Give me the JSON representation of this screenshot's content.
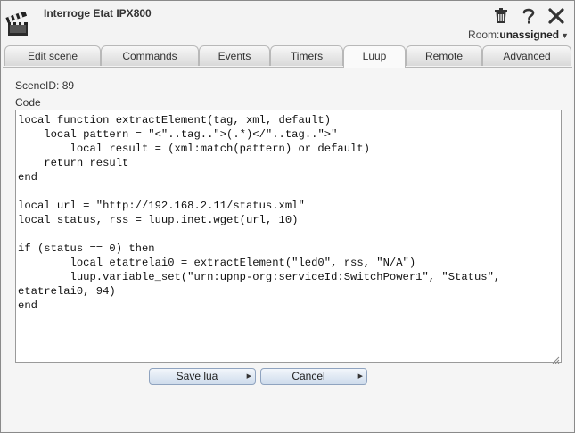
{
  "window": {
    "title": "Interroge Etat IPX800",
    "room_label": "Room:",
    "room_value": "unassigned"
  },
  "icons": {
    "app": "clapperboard-icon",
    "delete": "trash-icon",
    "help": "question-icon",
    "close": "close-icon"
  },
  "tabs": [
    {
      "label": "Edit scene",
      "active": false
    },
    {
      "label": "Commands",
      "active": false
    },
    {
      "label": "Events",
      "active": false
    },
    {
      "label": "Timers",
      "active": false
    },
    {
      "label": "Luup",
      "active": true
    },
    {
      "label": "Remote",
      "active": false
    },
    {
      "label": "Advanced",
      "active": false
    }
  ],
  "luup": {
    "scene_id_text": "SceneID: 89",
    "code_label": "Code",
    "code": "local function extractElement(tag, xml, default)\n    local pattern = \"<\"..tag..\">(.*)</\"..tag..\">\"\n        local result = (xml:match(pattern) or default)\n    return result\nend\n\nlocal url = \"http://192.168.2.11/status.xml\"\nlocal status, rss = luup.inet.wget(url, 10)\n\nif (status == 0) then\n        local etatrelai0 = extractElement(\"led0\", rss, \"N/A\")\n        luup.variable_set(\"urn:upnp-org:serviceId:SwitchPower1\", \"Status\",\netatrelai0, 94)\nend",
    "save_label": "Save lua",
    "cancel_label": "Cancel"
  }
}
